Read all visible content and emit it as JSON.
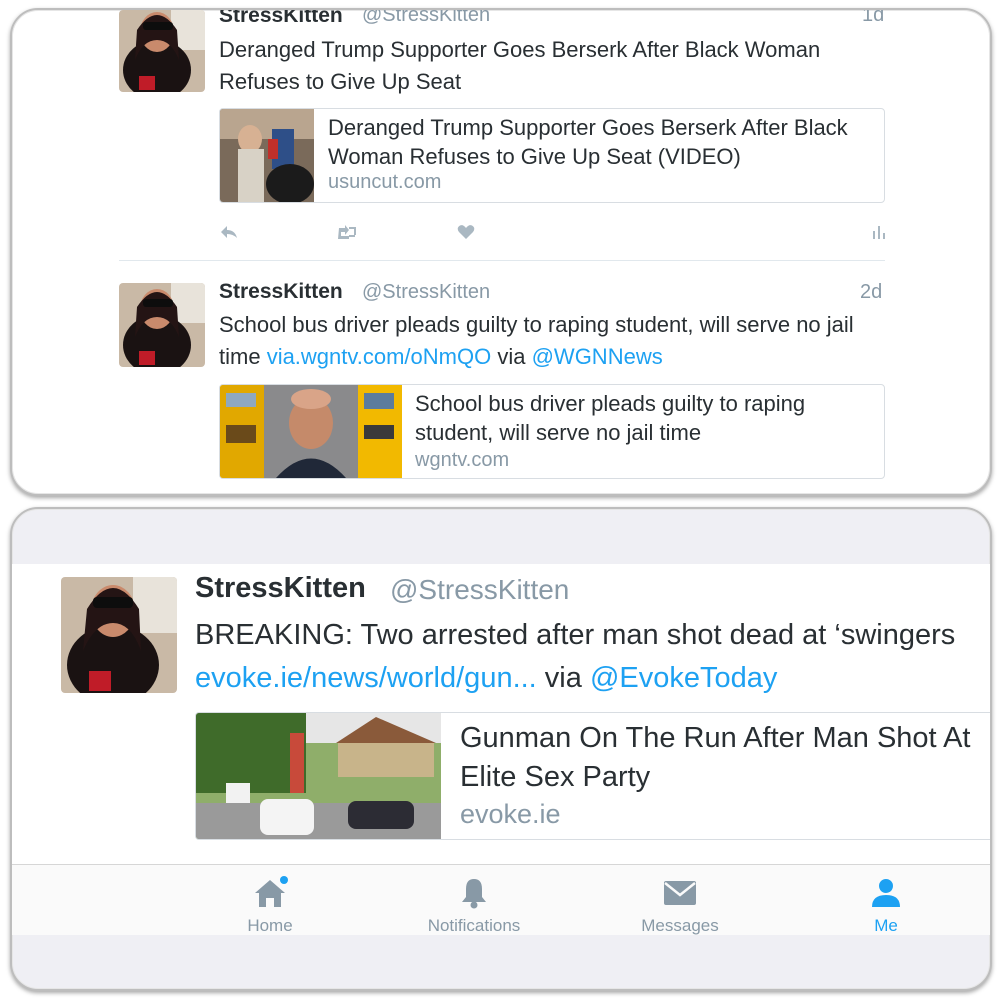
{
  "tweets_top": [
    {
      "name": "StressKitten",
      "handle": "@StressKitten",
      "time": "1d",
      "text": "Deranged Trump Supporter Goes Berserk After Black Woman Refuses to Give Up Seat",
      "card": {
        "title": "Deranged Trump Supporter Goes Berserk After Black Woman Refuses to Give Up Seat (VIDEO)",
        "domain": "usuncut.com"
      }
    },
    {
      "name": "StressKitten",
      "handle": "@StressKitten",
      "time": "2d",
      "text_prefix": "School bus driver pleads guilty to raping student, will serve no jail time ",
      "text_link": "via.wgntv.com/oNmQO",
      "text_via": " via ",
      "text_mention": "@WGNNews",
      "card": {
        "title": "School bus driver pleads guilty to raping student, will serve no jail time",
        "domain": "wgntv.com"
      }
    }
  ],
  "tweet_bottom": {
    "name": "StressKitten",
    "handle": "@StressKitten",
    "text": "BREAKING: Two arrested after man shot dead at ‘swingers",
    "link": "evoke.ie/news/world/gun...",
    "via": " via ",
    "mention": "@EvokeToday",
    "card": {
      "title": "Gunman On The Run After Man Shot At Elite Sex Party",
      "domain": "evoke.ie"
    }
  },
  "tabbar": {
    "home": "Home",
    "notifications": "Notifications",
    "messages": "Messages",
    "me": "Me"
  },
  "colors": {
    "accent": "#1da1f2",
    "muted": "#8899a6",
    "text": "#292f33"
  }
}
